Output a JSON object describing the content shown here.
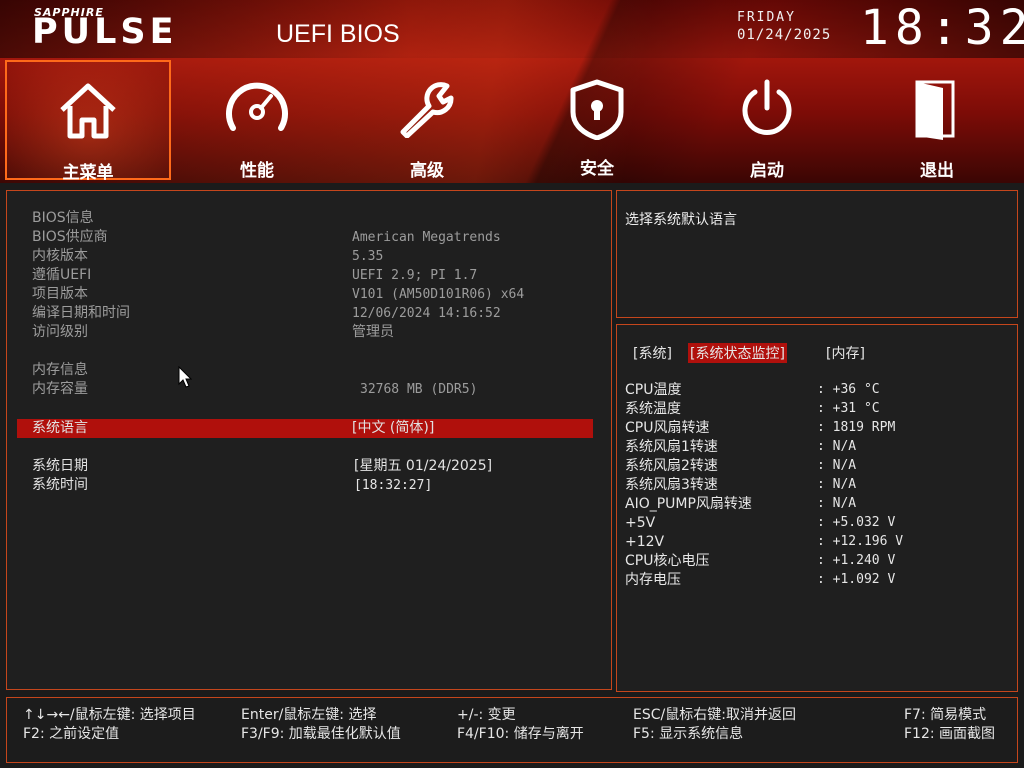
{
  "header": {
    "brand_top": "SAPPHIRE",
    "brand_main": "PULSE",
    "title": "UEFI BIOS",
    "day": "FRIDAY",
    "date": "01/24/2025",
    "time": "18:32"
  },
  "tabs": [
    {
      "label": "主菜单",
      "icon": "home-icon",
      "active": true
    },
    {
      "label": "性能",
      "icon": "speedometer-icon",
      "active": false
    },
    {
      "label": "高级",
      "icon": "wrench-icon",
      "active": false
    },
    {
      "label": "安全",
      "icon": "shield-lock-icon",
      "active": false
    },
    {
      "label": "启动",
      "icon": "power-icon",
      "active": false
    },
    {
      "label": "退出",
      "icon": "exit-door-icon",
      "active": false
    }
  ],
  "main": {
    "bios_info_label": "BIOS信息",
    "rows": [
      {
        "label": "BIOS供应商",
        "value": "American Megatrends"
      },
      {
        "label": "内核版本",
        "value": "5.35"
      },
      {
        "label": "遵循UEFI",
        "value": "UEFI 2.9; PI 1.7"
      },
      {
        "label": "项目版本",
        "value": "V101 (AM50D101R06) x64"
      },
      {
        "label": "编译日期和时间",
        "value": "12/06/2024 14:16:52"
      },
      {
        "label": "访问级别",
        "value": "管理员"
      }
    ],
    "memory_info_label": "内存信息",
    "memory_capacity_label": "内存容量",
    "memory_capacity_value": "32768 MB (DDR5)",
    "language_label": "系统语言",
    "language_value": "[中文 (简体)]",
    "date_label": "系统日期",
    "date_value": "[星期五 01/24/2025]",
    "time_label": "系统时间",
    "time_value": "[18:32:27]"
  },
  "help": {
    "text": "选择系统默认语言"
  },
  "status": {
    "tabs": [
      "[系统]",
      "[系统状态监控]",
      "[内存]"
    ],
    "active_tab": 1,
    "rows": [
      {
        "label": "CPU温度",
        "value": ": +36 °C"
      },
      {
        "label": "系统温度",
        "value": ": +31 °C"
      },
      {
        "label": "CPU风扇转速",
        "value": ": 1819 RPM"
      },
      {
        "label": "系统风扇1转速",
        "value": ": N/A"
      },
      {
        "label": "系统风扇2转速",
        "value": ": N/A"
      },
      {
        "label": "系统风扇3转速",
        "value": ": N/A"
      },
      {
        "label": "AIO_PUMP风扇转速",
        "value": ": N/A"
      },
      {
        "label": "+5V",
        "value": ": +5.032 V"
      },
      {
        "label": "+12V",
        "value": ": +12.196 V"
      },
      {
        "label": "CPU核心电压",
        "value": ": +1.240 V"
      },
      {
        "label": "内存电压",
        "value": ": +1.092 V"
      }
    ]
  },
  "footer": {
    "r1c1": "↑↓→←/鼠标左键: 选择项目",
    "r1c2": "Enter/鼠标左键: 选择",
    "r1c3": "+/-: 变更",
    "r1c4": "ESC/鼠标右键:取消并返回",
    "r1c5": "F7: 简易模式",
    "r2c1": "F2: 之前设定值",
    "r2c2": "F3/F9: 加载最佳化默认值",
    "r2c3": "F4/F10: 储存与离开",
    "r2c4": "F5: 显示系统信息",
    "r2c5": "F12: 画面截图"
  },
  "colors": {
    "accent": "#c5461c",
    "highlight": "#b0100c",
    "header_red": "#a4170d"
  }
}
